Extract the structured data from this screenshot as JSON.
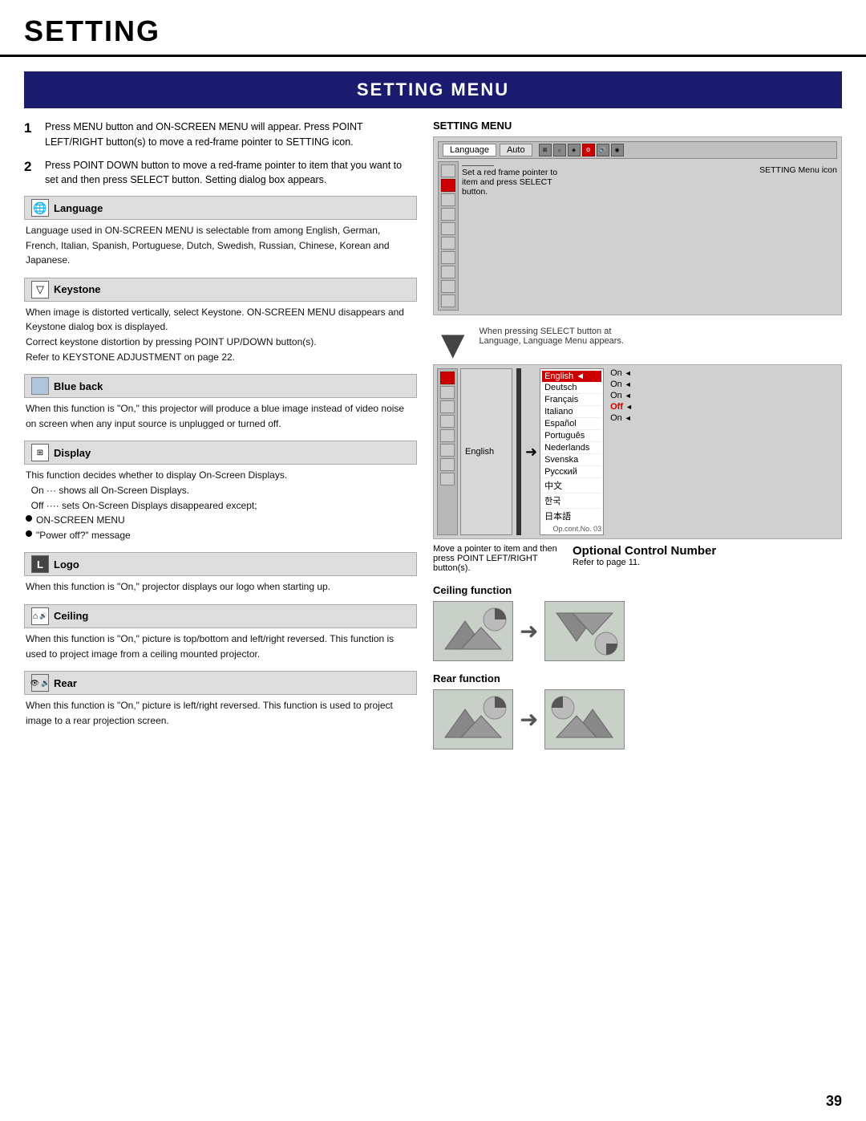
{
  "page": {
    "title": "SETTING",
    "section_title": "SETTING MENU",
    "page_number": "39"
  },
  "steps": [
    {
      "num": "1",
      "text": "Press MENU button and ON-SCREEN MENU will appear.  Press POINT LEFT/RIGHT button(s) to move a red-frame pointer to SETTING icon."
    },
    {
      "num": "2",
      "text": "Press POINT DOWN button to move a red-frame pointer to item that you want to set and then press SELECT button.  Setting dialog box appears."
    }
  ],
  "sections": [
    {
      "id": "language",
      "icon": "🌐",
      "label": "Language",
      "body": "Language used in ON-SCREEN MENU is selectable from among English, German, French, Italian, Spanish, Portuguese, Dutch, Swedish, Russian, Chinese, Korean and Japanese."
    },
    {
      "id": "keystone",
      "icon": "▽",
      "label": "Keystone",
      "body": "When image is distorted vertically, select Keystone.  ON-SCREEN MENU disappears and Keystone dialog box is displayed.\nCorrect keystone distortion by pressing POINT UP/DOWN button(s).\nRefer to KEYSTONE ADJUSTMENT on page 22."
    },
    {
      "id": "blue-back",
      "icon": "☐",
      "label": "Blue back",
      "body": "When this function is \"On,\" this projector will produce a blue image instead of video noise on screen when any input source is unplugged or turned off."
    },
    {
      "id": "display",
      "icon": "⊞",
      "label": "Display",
      "body_lines": [
        "This function decides whether to display On-Screen Displays.",
        "On ···  shows all On-Screen Displays.",
        "Off ····  sets On-Screen Displays disappeared except;"
      ],
      "bullets": [
        "ON-SCREEN MENU",
        "\"Power off?\" message"
      ]
    },
    {
      "id": "logo",
      "icon": "L",
      "label": "Logo",
      "body": "When this function is \"On,\" projector displays our logo when starting up."
    },
    {
      "id": "ceiling",
      "icon": "⌂",
      "label": "Ceiling",
      "body": "When this function is \"On,\" picture is top/bottom and left/right reversed. This function is used to project image from a ceiling mounted projector."
    },
    {
      "id": "rear",
      "icon": "◉",
      "label": "Rear",
      "body": "When this function is \"On,\" picture is left/right reversed.  This function is used to project image to a rear projection screen."
    }
  ],
  "right_panel": {
    "setting_menu_title": "SETTING MENU",
    "menu_bar": {
      "left_label": "Language",
      "right_label": "Auto"
    },
    "annotations": {
      "red_frame": "Set a red frame pointer to item and press SELECT button.",
      "menu_icon": "SETTING Menu icon"
    },
    "arrow_label": "When pressing SELECT button at Language, Language Menu appears.",
    "language_menu": {
      "left_item": "English",
      "languages": [
        {
          "name": "English",
          "selected": true
        },
        {
          "name": "Deutsch",
          "selected": false
        },
        {
          "name": "Français",
          "selected": false
        },
        {
          "name": "Italiano",
          "selected": false
        },
        {
          "name": "Español",
          "selected": false
        },
        {
          "name": "Português",
          "selected": false
        },
        {
          "name": "Nederlands",
          "selected": false
        },
        {
          "name": "Svenska",
          "selected": false
        },
        {
          "name": "Русский",
          "selected": false
        },
        {
          "name": "中文",
          "selected": false
        },
        {
          "name": "한국",
          "selected": false
        },
        {
          "name": "日本語",
          "selected": false
        }
      ],
      "op_cont": "Op.cont.No. 03"
    },
    "move_pointer_label": "Move a pointer to item and then press POINT LEFT/RIGHT button(s).",
    "optional_control": {
      "title": "Optional Control Number",
      "subtitle": "Refer to page 11."
    },
    "ceiling_function": {
      "title": "Ceiling function"
    },
    "rear_function": {
      "title": "Rear function"
    },
    "left_menu_rows": [
      {
        "label": "",
        "val": "On",
        "has_arrow": true
      },
      {
        "label": "",
        "val": "On",
        "has_arrow": true
      },
      {
        "label": "",
        "val": "On",
        "has_arrow": true
      },
      {
        "label": "",
        "val": "Off",
        "has_arrow": true
      },
      {
        "label": "",
        "val": "On",
        "has_arrow": true
      }
    ]
  }
}
